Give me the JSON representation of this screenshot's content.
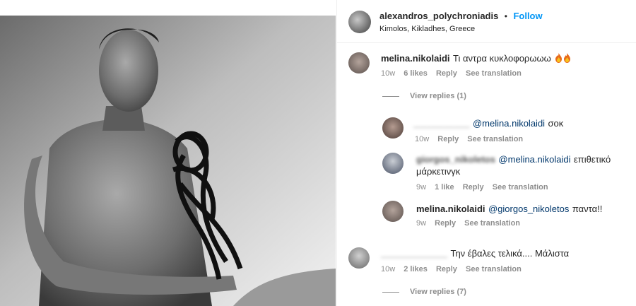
{
  "post": {
    "username": "alexandros_polychroniadis",
    "dot": "•",
    "follow_label": "Follow",
    "location": "Kimolos, Kikladhes, Greece"
  },
  "comments": [
    {
      "user": "melina.nikolaidi",
      "text": "Τι αντρα κυκλοφορωωω",
      "emoji": "fire-icon fire-icon",
      "age": "10w",
      "likes": "6 likes",
      "reply": "Reply",
      "see_translation": "See translation",
      "view_replies": "View replies (1)",
      "replies": [
        {
          "user": "",
          "mention": "@melina.nikolaidi",
          "text": "σοκ",
          "age": "10w",
          "reply": "Reply",
          "see_translation": "See translation"
        },
        {
          "user": "giorgos_nikoletos",
          "mention": "@melina.nikolaidi",
          "text_line1": "επιθετικό",
          "text_line2": "μάρκετινγκ",
          "age": "9w",
          "likes": "1 like",
          "reply": "Reply",
          "see_translation": "See translation"
        },
        {
          "user": "melina.nikolaidi",
          "mention": "@giorgos_nikoletos",
          "text": "παντα!!",
          "age": "9w",
          "reply": "Reply",
          "see_translation": "See translation"
        }
      ]
    },
    {
      "user": "",
      "text": "Την έβαλες τελικά.... Μάλιστα",
      "age": "10w",
      "likes": "2 likes",
      "reply": "Reply",
      "see_translation": "See translation",
      "view_replies": "View replies (7)"
    }
  ]
}
